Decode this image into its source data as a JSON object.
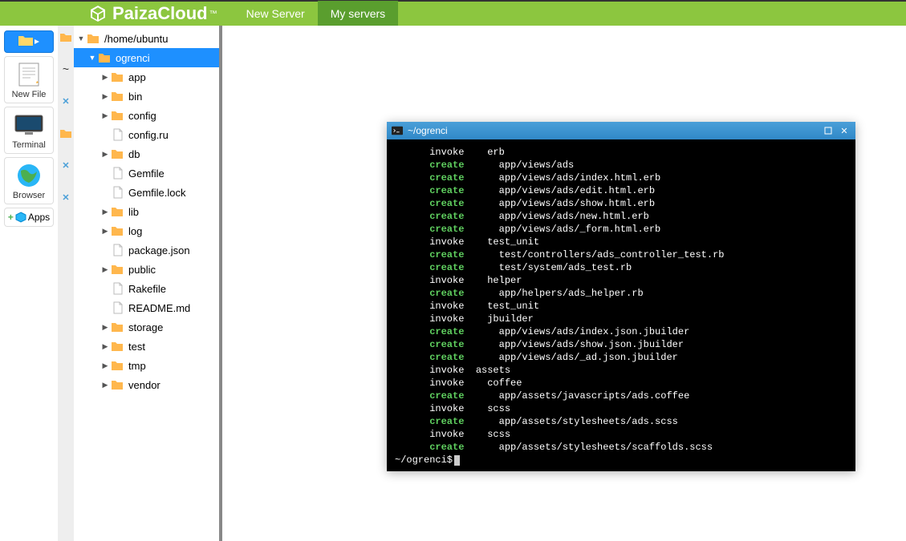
{
  "header": {
    "brand": "PaizaCloud",
    "new_server": "New Server",
    "my_servers": "My servers"
  },
  "launcher": {
    "new_file": "New File",
    "terminal": "Terminal",
    "browser": "Browser",
    "apps": "Apps"
  },
  "tree": {
    "root": "/home/ubuntu",
    "selected": "ogrenci",
    "items": [
      {
        "name": "app",
        "type": "folder",
        "arrow": "▶"
      },
      {
        "name": "bin",
        "type": "folder",
        "arrow": "▶"
      },
      {
        "name": "config",
        "type": "folder",
        "arrow": "▶"
      },
      {
        "name": "config.ru",
        "type": "file",
        "arrow": ""
      },
      {
        "name": "db",
        "type": "folder",
        "arrow": "▶"
      },
      {
        "name": "Gemfile",
        "type": "file",
        "arrow": ""
      },
      {
        "name": "Gemfile.lock",
        "type": "file",
        "arrow": ""
      },
      {
        "name": "lib",
        "type": "folder",
        "arrow": "▶"
      },
      {
        "name": "log",
        "type": "folder",
        "arrow": "▶"
      },
      {
        "name": "package.json",
        "type": "file",
        "arrow": ""
      },
      {
        "name": "public",
        "type": "folder",
        "arrow": "▶"
      },
      {
        "name": "Rakefile",
        "type": "file",
        "arrow": ""
      },
      {
        "name": "README.md",
        "type": "file",
        "arrow": ""
      },
      {
        "name": "storage",
        "type": "folder",
        "arrow": "▶"
      },
      {
        "name": "test",
        "type": "folder",
        "arrow": "▶"
      },
      {
        "name": "tmp",
        "type": "folder",
        "arrow": "▶"
      },
      {
        "name": "vendor",
        "type": "folder",
        "arrow": "▶"
      }
    ]
  },
  "terminal": {
    "title": "~/ogrenci",
    "prompt": "~/ogrenci$",
    "lines": [
      {
        "action": "invoke",
        "path": "erb"
      },
      {
        "action": "create",
        "path": "app/views/ads"
      },
      {
        "action": "create",
        "path": "app/views/ads/index.html.erb"
      },
      {
        "action": "create",
        "path": "app/views/ads/edit.html.erb"
      },
      {
        "action": "create",
        "path": "app/views/ads/show.html.erb"
      },
      {
        "action": "create",
        "path": "app/views/ads/new.html.erb"
      },
      {
        "action": "create",
        "path": "app/views/ads/_form.html.erb"
      },
      {
        "action": "invoke",
        "path": "test_unit"
      },
      {
        "action": "create",
        "path": "test/controllers/ads_controller_test.rb"
      },
      {
        "action": "create",
        "path": "test/system/ads_test.rb"
      },
      {
        "action": "invoke",
        "path": "helper",
        "indent": 0
      },
      {
        "action": "create",
        "path": "app/helpers/ads_helper.rb"
      },
      {
        "action": "invoke",
        "path": "test_unit"
      },
      {
        "action": "invoke",
        "path": "jbuilder",
        "indent": 0
      },
      {
        "action": "create",
        "path": "app/views/ads/index.json.jbuilder"
      },
      {
        "action": "create",
        "path": "app/views/ads/show.json.jbuilder"
      },
      {
        "action": "create",
        "path": "app/views/ads/_ad.json.jbuilder"
      },
      {
        "action": "invoke",
        "path": "assets",
        "indent": -1
      },
      {
        "action": "invoke",
        "path": "coffee",
        "indent": 0
      },
      {
        "action": "create",
        "path": "app/assets/javascripts/ads.coffee"
      },
      {
        "action": "invoke",
        "path": "scss",
        "indent": 0
      },
      {
        "action": "create",
        "path": "app/assets/stylesheets/ads.scss"
      },
      {
        "action": "invoke",
        "path": "scss",
        "indent": 0
      },
      {
        "action": "create",
        "path": "app/assets/stylesheets/scaffolds.scss"
      }
    ]
  }
}
